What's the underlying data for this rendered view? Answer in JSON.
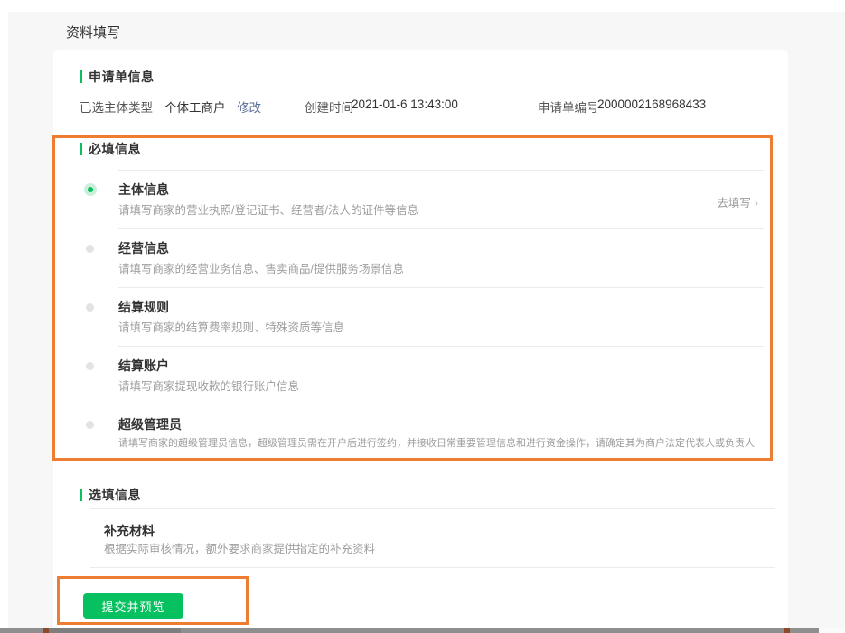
{
  "page": {
    "title": "资料填写"
  },
  "application_info": {
    "section_title": "申请单信息",
    "subject_type_label": "已选主体类型",
    "subject_type_value": "个体工商户",
    "modify_link": "修改",
    "created_label": "创建时间",
    "created_value": "2021-01-6 13:43:00",
    "application_no_label": "申请单编号",
    "application_no_value": "2000002168968433"
  },
  "required_info": {
    "section_title": "必填信息",
    "action_label": "去填写",
    "action_chevron": "›",
    "items": [
      {
        "title": "主体信息",
        "desc": "请填写商家的营业执照/登记证书、经营者/法人的证件等信息",
        "selected": true
      },
      {
        "title": "经营信息",
        "desc": "请填写商家的经营业务信息、售卖商品/提供服务场景信息",
        "selected": false
      },
      {
        "title": "结算规则",
        "desc": "请填写商家的结算费率规则、特殊资质等信息",
        "selected": false
      },
      {
        "title": "结算账户",
        "desc": "请填写商家提现收款的银行账户信息",
        "selected": false
      },
      {
        "title": "超级管理员",
        "desc": "请填写商家的超级管理员信息，超级管理员需在开户后进行签约，并接收日常重要管理信息和进行资金操作，请确定其为商户法定代表人或负责人",
        "selected": false
      }
    ]
  },
  "optional_info": {
    "section_title": "选填信息",
    "items": [
      {
        "title": "补充材料",
        "desc": "根据实际审核情况，额外要求商家提供指定的补充资料"
      }
    ]
  },
  "footer": {
    "submit_label": "提交并预览"
  },
  "colors": {
    "accent_green": "#07c160",
    "highlight_orange": "#ed7d31",
    "link_blue": "#576b95"
  }
}
